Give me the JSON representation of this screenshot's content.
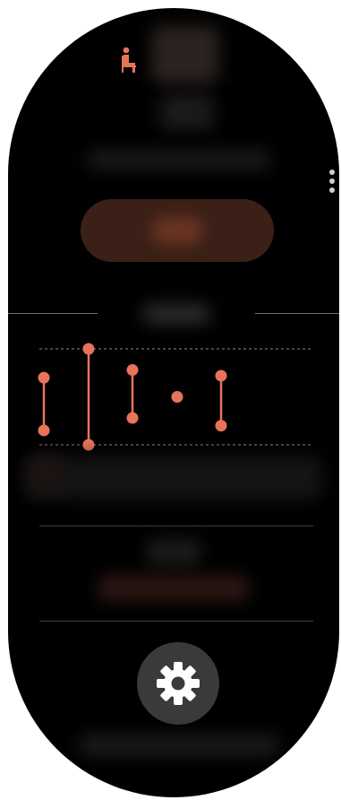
{
  "colors": {
    "accent": "#e8735a",
    "background": "#000000",
    "action_button": "#3a2016",
    "settings_button": "#3a3a3a",
    "divider": "#6e6e6e"
  },
  "header": {
    "activity_icon": "sitting-person-icon"
  },
  "menu": {
    "icon": "more-options-icon"
  },
  "settings": {
    "icon": "gear-icon"
  },
  "chart_data": {
    "type": "range",
    "range_bars": [
      {
        "low": 0.15,
        "high": 0.7
      },
      {
        "low": 0.0,
        "high": 1.0
      },
      {
        "low": 0.28,
        "high": 0.78
      },
      {
        "low": 0.5,
        "high": 0.5
      },
      {
        "low": 0.2,
        "high": 0.72
      }
    ],
    "ylim": [
      0,
      1
    ],
    "reference_lines": "dashed"
  }
}
